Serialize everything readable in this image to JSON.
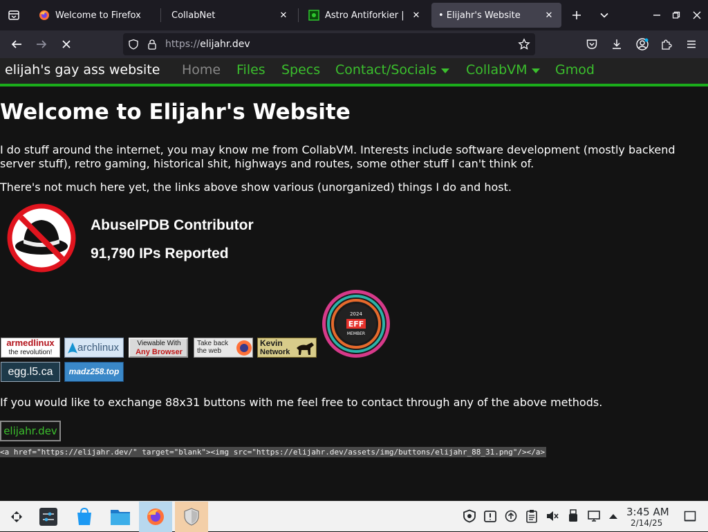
{
  "tabs": [
    {
      "title": "Welcome to Firefox"
    },
    {
      "title": "CollabNet"
    },
    {
      "title": "Astro Antiforkier | Th"
    },
    {
      "title": "• Elijahr's Website"
    }
  ],
  "urlbar": {
    "scheme": "https://",
    "host": "elijahr.dev"
  },
  "site": {
    "brand": "elijah's gay ass website",
    "nav": [
      {
        "label": "Home"
      },
      {
        "label": "Files"
      },
      {
        "label": "Specs"
      },
      {
        "label": "Contact/Socials"
      },
      {
        "label": "CollabVM"
      },
      {
        "label": "Gmod"
      }
    ],
    "heading": "Welcome to Elijahr's Website",
    "intro": "I do stuff around the internet, you may know me from CollabVM. Interests include software development (mostly backend server stuff), retro gaming, historical shit, highways and routes, some other stuff I can't think of.",
    "note": "There's not much here yet, the links above show various (unorganized) things I do and host.",
    "abuse_title": "AbuseIPDB Contributor",
    "abuse_count": "91,790 IPs Reported",
    "eff": {
      "year": "2024",
      "logo": "EFF",
      "label": "MEMBER"
    },
    "buttons": [
      {
        "line1": "armedlinux",
        "line2": "the revolution!"
      },
      {
        "line1": "archlinux"
      },
      {
        "line1": "Viewable With",
        "line2": "Any Browser"
      },
      {
        "line1": "Take back",
        "line2": "the web"
      },
      {
        "line1": "Kevin",
        "line2": "Network"
      },
      {
        "line1": "egg.l5.ca"
      },
      {
        "line1": "madz258.top"
      }
    ],
    "exchange_text": "If you would like to exchange 88x31 buttons with me feel free to contact through any of the above methods.",
    "self_button": "elijahr.dev",
    "code_snippet": "<a href=\"https://elijahr.dev/\" target=\"blank\"><img src=\"https://elijahr.dev/assets/img/buttons/elijahr_88_31.png\"/></a>"
  },
  "taskbar": {
    "time": "3:45 AM",
    "date": "2/14/25"
  },
  "colors": {
    "accent_green": "#3bbf2d",
    "nav_border": "#1bad1b"
  }
}
